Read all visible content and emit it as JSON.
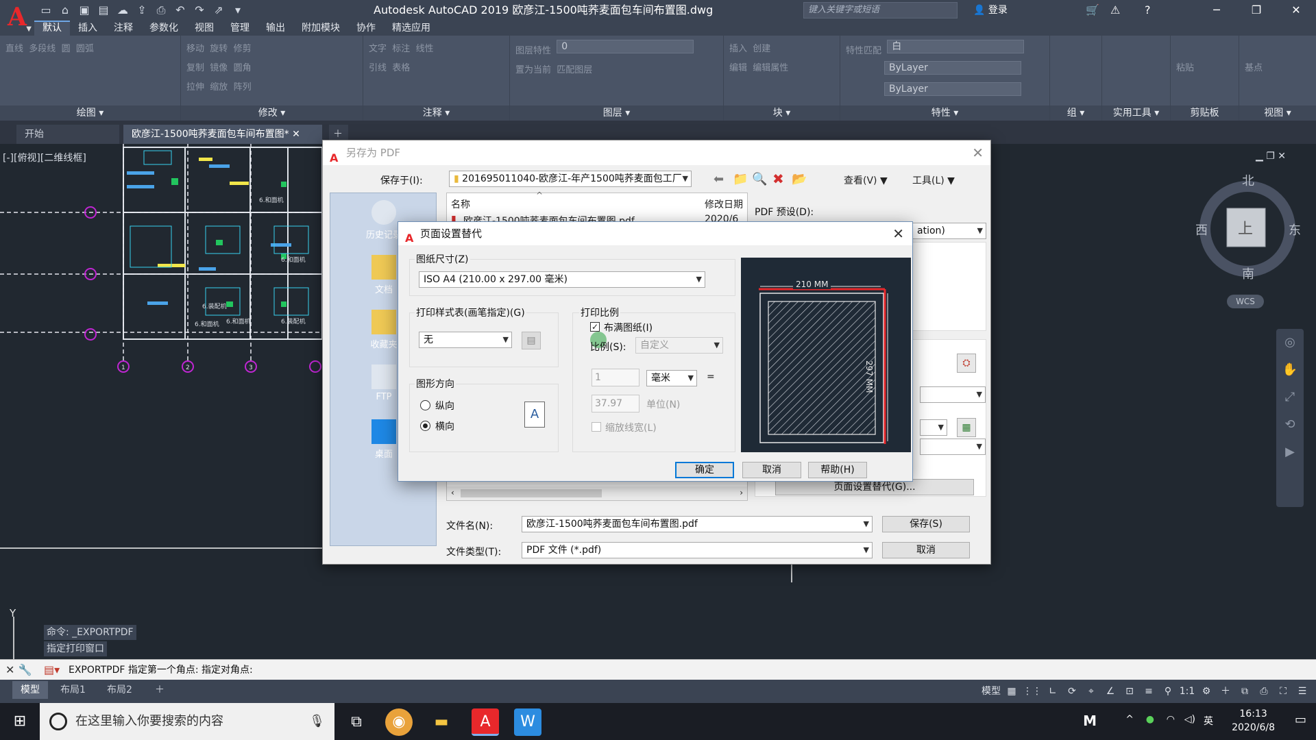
{
  "app": {
    "title": "Autodesk AutoCAD 2019    欧彦江-1500吨荞麦面包车间布置图.dwg",
    "logo": "A",
    "search_placeholder": "键入关键字或短语",
    "login": "登录"
  },
  "ribbon": {
    "tabs": [
      "默认",
      "插入",
      "注释",
      "参数化",
      "视图",
      "管理",
      "输出",
      "附加模块",
      "协作",
      "精选应用"
    ],
    "active_tab": "默认",
    "panels": [
      "绘图",
      "修改",
      "注释",
      "图层",
      "块",
      "特性",
      "组",
      "实用工具",
      "剪贴板",
      "视图"
    ],
    "draw_tools": [
      "直线",
      "多段线",
      "圆",
      "圆弧"
    ],
    "modify_tools": [
      "移动",
      "旋转",
      "修剪",
      "复制",
      "镜像",
      "圆角",
      "拉伸",
      "缩放",
      "阵列"
    ],
    "annot_tools": [
      "文字",
      "标注",
      "线性",
      "引线",
      "表格"
    ],
    "layer_tools": [
      "图层特性",
      "置为当前",
      "匹配图层"
    ],
    "layer_name": "0",
    "block_tools": [
      "插入",
      "创建",
      "编辑",
      "编辑属性"
    ],
    "prop_tools": [
      "特性匹配"
    ],
    "color_value": "白",
    "linetype_value": "ByLayer",
    "lineweight_value": "ByLayer",
    "clipboard_tool": "粘贴",
    "base_tool": "基点"
  },
  "doc_tabs": [
    "开始",
    "欧彦江-1500吨荞麦面包车间布置图*"
  ],
  "viewport_label": "[-][俯视][二维线框]",
  "viewcube": {
    "north": "北",
    "south": "南",
    "east": "东",
    "west": "西",
    "face": "上",
    "wcs": "WCS"
  },
  "drawing_labels": [
    "6.和面机",
    "6.和面机",
    "6.装配机",
    "6.装配机",
    "6.和面机",
    "6.和面机"
  ],
  "axis_marks": [
    "1",
    "2",
    "3"
  ],
  "command": {
    "history": [
      "命令: _EXPORTPDF",
      "指定打印窗口"
    ],
    "current": "EXPORTPDF 指定第一个角点: 指定对角点:"
  },
  "layout_tabs": [
    "模型",
    "布局1",
    "布局2"
  ],
  "status": {
    "model_label": "模型",
    "scale": "1:1"
  },
  "taskbar": {
    "search_placeholder": "在这里输入你要搜索的内容",
    "time": "16:13",
    "date": "2020/6/8",
    "ime": "英",
    "m_label": "M"
  },
  "pdf_dialog": {
    "title": "另存为 PDF",
    "save_in_label": "保存于(I):",
    "save_in_value": "201695011040-欧彦江-年产1500吨荞麦面包工厂",
    "view_menu": "查看(V)",
    "tools_menu": "工具(L)",
    "places": [
      "历史记录",
      "文档",
      "收藏夹",
      "FTP",
      "桌面"
    ],
    "col_name": "名称",
    "col_modified": "修改日期",
    "file_row": "欧彦江-1500吨荞麦面包车间布置图.pdf",
    "file_date": "2020/6",
    "pdf_preset_label": "PDF 预设(D):",
    "pdf_preset_value": "ation)",
    "page_setup_override_button": "页面设置替代(G)...",
    "filename_label": "文件名(N):",
    "filename_value": "欧彦江-1500吨荞麦面包车间布置图.pdf",
    "filetype_label": "文件类型(T):",
    "filetype_value": "PDF 文件 (*.pdf)",
    "save_button": "保存(S)",
    "cancel_button": "取消"
  },
  "page_setup": {
    "title": "页面设置替代",
    "paper_size_label": "图纸尺寸(Z)",
    "paper_size_value": "ISO A4 (210.00 x 297.00 毫米)",
    "plot_style_label": "打印样式表(画笔指定)(G)",
    "plot_style_value": "无",
    "orientation_label": "图形方向",
    "portrait": "纵向",
    "landscape": "横向",
    "orientation_selected": "横向",
    "scale_label": "打印比例",
    "fit_paper": "布满图纸(I)",
    "fit_paper_checked": true,
    "scale_field_label": "比例(S):",
    "scale_value": "自定义",
    "unit_value_1": "1",
    "unit_select": "毫米",
    "equals": "=",
    "unit_value_2": "37.97",
    "unit_label": "单位(N)",
    "scale_lineweights": "缩放线宽(L)",
    "preview_width": "210 MM",
    "preview_height": "297 MM",
    "ok_button": "确定",
    "cancel_button": "取消",
    "help_button": "帮助(H)"
  },
  "colors": {
    "autocad_red": "#e8282b",
    "ribbon_bg": "#4a5466",
    "canvas_bg": "#212830",
    "accent_blue": "#0078d7"
  }
}
